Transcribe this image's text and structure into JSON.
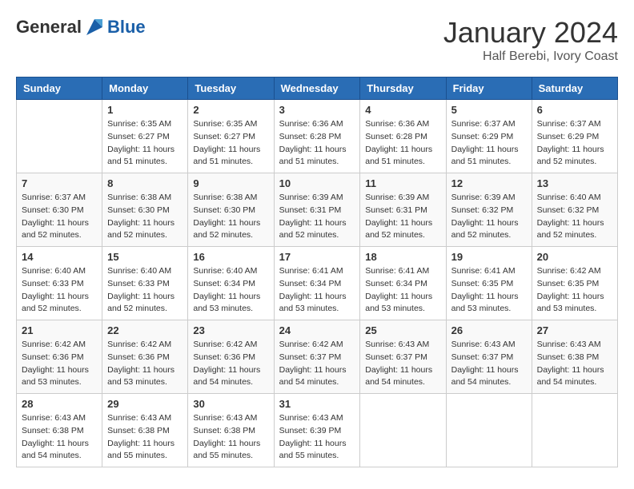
{
  "header": {
    "logo_general": "General",
    "logo_blue": "Blue",
    "month": "January 2024",
    "location": "Half Berebi, Ivory Coast"
  },
  "days_of_week": [
    "Sunday",
    "Monday",
    "Tuesday",
    "Wednesday",
    "Thursday",
    "Friday",
    "Saturday"
  ],
  "weeks": [
    [
      {
        "day": "",
        "sunrise": "",
        "sunset": "",
        "daylight": ""
      },
      {
        "day": "1",
        "sunrise": "Sunrise: 6:35 AM",
        "sunset": "Sunset: 6:27 PM",
        "daylight": "Daylight: 11 hours and 51 minutes."
      },
      {
        "day": "2",
        "sunrise": "Sunrise: 6:35 AM",
        "sunset": "Sunset: 6:27 PM",
        "daylight": "Daylight: 11 hours and 51 minutes."
      },
      {
        "day": "3",
        "sunrise": "Sunrise: 6:36 AM",
        "sunset": "Sunset: 6:28 PM",
        "daylight": "Daylight: 11 hours and 51 minutes."
      },
      {
        "day": "4",
        "sunrise": "Sunrise: 6:36 AM",
        "sunset": "Sunset: 6:28 PM",
        "daylight": "Daylight: 11 hours and 51 minutes."
      },
      {
        "day": "5",
        "sunrise": "Sunrise: 6:37 AM",
        "sunset": "Sunset: 6:29 PM",
        "daylight": "Daylight: 11 hours and 51 minutes."
      },
      {
        "day": "6",
        "sunrise": "Sunrise: 6:37 AM",
        "sunset": "Sunset: 6:29 PM",
        "daylight": "Daylight: 11 hours and 52 minutes."
      }
    ],
    [
      {
        "day": "7",
        "sunrise": "Sunrise: 6:37 AM",
        "sunset": "Sunset: 6:30 PM",
        "daylight": "Daylight: 11 hours and 52 minutes."
      },
      {
        "day": "8",
        "sunrise": "Sunrise: 6:38 AM",
        "sunset": "Sunset: 6:30 PM",
        "daylight": "Daylight: 11 hours and 52 minutes."
      },
      {
        "day": "9",
        "sunrise": "Sunrise: 6:38 AM",
        "sunset": "Sunset: 6:30 PM",
        "daylight": "Daylight: 11 hours and 52 minutes."
      },
      {
        "day": "10",
        "sunrise": "Sunrise: 6:39 AM",
        "sunset": "Sunset: 6:31 PM",
        "daylight": "Daylight: 11 hours and 52 minutes."
      },
      {
        "day": "11",
        "sunrise": "Sunrise: 6:39 AM",
        "sunset": "Sunset: 6:31 PM",
        "daylight": "Daylight: 11 hours and 52 minutes."
      },
      {
        "day": "12",
        "sunrise": "Sunrise: 6:39 AM",
        "sunset": "Sunset: 6:32 PM",
        "daylight": "Daylight: 11 hours and 52 minutes."
      },
      {
        "day": "13",
        "sunrise": "Sunrise: 6:40 AM",
        "sunset": "Sunset: 6:32 PM",
        "daylight": "Daylight: 11 hours and 52 minutes."
      }
    ],
    [
      {
        "day": "14",
        "sunrise": "Sunrise: 6:40 AM",
        "sunset": "Sunset: 6:33 PM",
        "daylight": "Daylight: 11 hours and 52 minutes."
      },
      {
        "day": "15",
        "sunrise": "Sunrise: 6:40 AM",
        "sunset": "Sunset: 6:33 PM",
        "daylight": "Daylight: 11 hours and 52 minutes."
      },
      {
        "day": "16",
        "sunrise": "Sunrise: 6:40 AM",
        "sunset": "Sunset: 6:34 PM",
        "daylight": "Daylight: 11 hours and 53 minutes."
      },
      {
        "day": "17",
        "sunrise": "Sunrise: 6:41 AM",
        "sunset": "Sunset: 6:34 PM",
        "daylight": "Daylight: 11 hours and 53 minutes."
      },
      {
        "day": "18",
        "sunrise": "Sunrise: 6:41 AM",
        "sunset": "Sunset: 6:34 PM",
        "daylight": "Daylight: 11 hours and 53 minutes."
      },
      {
        "day": "19",
        "sunrise": "Sunrise: 6:41 AM",
        "sunset": "Sunset: 6:35 PM",
        "daylight": "Daylight: 11 hours and 53 minutes."
      },
      {
        "day": "20",
        "sunrise": "Sunrise: 6:42 AM",
        "sunset": "Sunset: 6:35 PM",
        "daylight": "Daylight: 11 hours and 53 minutes."
      }
    ],
    [
      {
        "day": "21",
        "sunrise": "Sunrise: 6:42 AM",
        "sunset": "Sunset: 6:36 PM",
        "daylight": "Daylight: 11 hours and 53 minutes."
      },
      {
        "day": "22",
        "sunrise": "Sunrise: 6:42 AM",
        "sunset": "Sunset: 6:36 PM",
        "daylight": "Daylight: 11 hours and 53 minutes."
      },
      {
        "day": "23",
        "sunrise": "Sunrise: 6:42 AM",
        "sunset": "Sunset: 6:36 PM",
        "daylight": "Daylight: 11 hours and 54 minutes."
      },
      {
        "day": "24",
        "sunrise": "Sunrise: 6:42 AM",
        "sunset": "Sunset: 6:37 PM",
        "daylight": "Daylight: 11 hours and 54 minutes."
      },
      {
        "day": "25",
        "sunrise": "Sunrise: 6:43 AM",
        "sunset": "Sunset: 6:37 PM",
        "daylight": "Daylight: 11 hours and 54 minutes."
      },
      {
        "day": "26",
        "sunrise": "Sunrise: 6:43 AM",
        "sunset": "Sunset: 6:37 PM",
        "daylight": "Daylight: 11 hours and 54 minutes."
      },
      {
        "day": "27",
        "sunrise": "Sunrise: 6:43 AM",
        "sunset": "Sunset: 6:38 PM",
        "daylight": "Daylight: 11 hours and 54 minutes."
      }
    ],
    [
      {
        "day": "28",
        "sunrise": "Sunrise: 6:43 AM",
        "sunset": "Sunset: 6:38 PM",
        "daylight": "Daylight: 11 hours and 54 minutes."
      },
      {
        "day": "29",
        "sunrise": "Sunrise: 6:43 AM",
        "sunset": "Sunset: 6:38 PM",
        "daylight": "Daylight: 11 hours and 55 minutes."
      },
      {
        "day": "30",
        "sunrise": "Sunrise: 6:43 AM",
        "sunset": "Sunset: 6:38 PM",
        "daylight": "Daylight: 11 hours and 55 minutes."
      },
      {
        "day": "31",
        "sunrise": "Sunrise: 6:43 AM",
        "sunset": "Sunset: 6:39 PM",
        "daylight": "Daylight: 11 hours and 55 minutes."
      },
      {
        "day": "",
        "sunrise": "",
        "sunset": "",
        "daylight": ""
      },
      {
        "day": "",
        "sunrise": "",
        "sunset": "",
        "daylight": ""
      },
      {
        "day": "",
        "sunrise": "",
        "sunset": "",
        "daylight": ""
      }
    ]
  ]
}
